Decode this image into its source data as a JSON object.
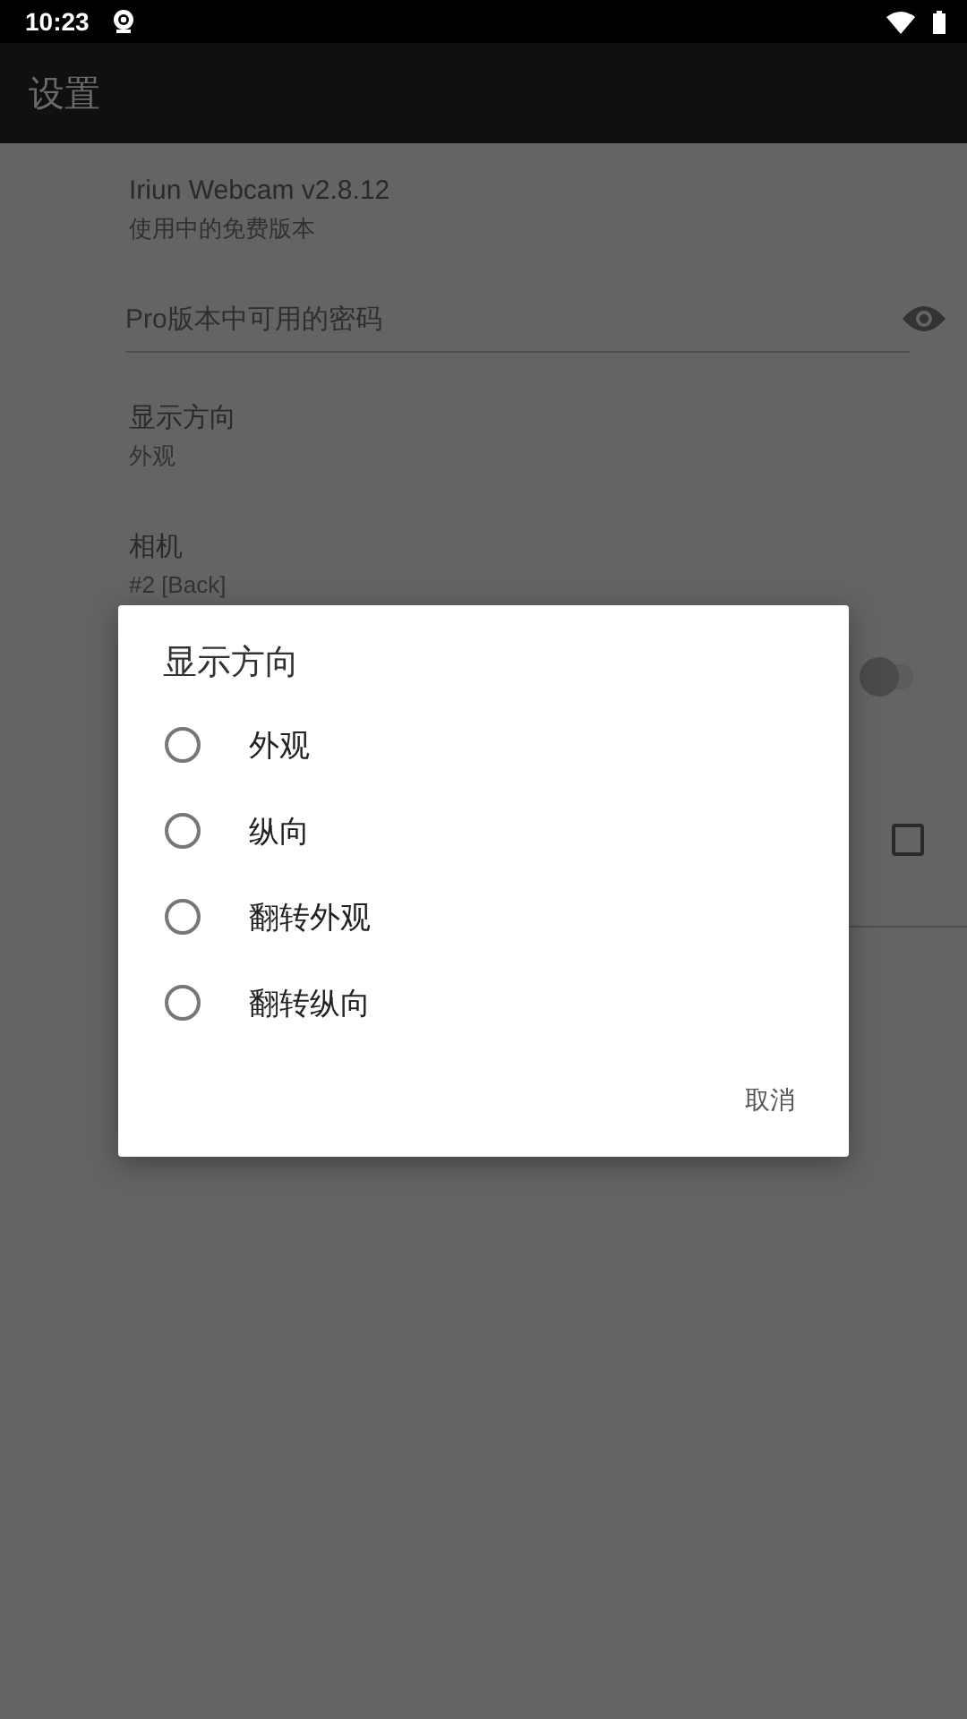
{
  "status_bar": {
    "time": "10:23"
  },
  "app_bar": {
    "title": "设置"
  },
  "settings": {
    "version": {
      "title": "Iriun Webcam v2.8.12",
      "subtitle": "使用中的免费版本"
    },
    "password": {
      "placeholder": "Pro版本中可用的密码"
    },
    "items": [
      {
        "title": "显示方向",
        "subtitle": "外观"
      },
      {
        "title": "相机",
        "subtitle": "#2 [Back]"
      }
    ],
    "switch": {
      "on": false
    },
    "checkbox": {
      "checked": false
    }
  },
  "dialog": {
    "title": "显示方向",
    "options": [
      {
        "label": "外观",
        "selected": false
      },
      {
        "label": "纵向",
        "selected": false
      },
      {
        "label": "翻转外观",
        "selected": false
      },
      {
        "label": "翻转纵向",
        "selected": false
      }
    ],
    "cancel": "取消"
  }
}
